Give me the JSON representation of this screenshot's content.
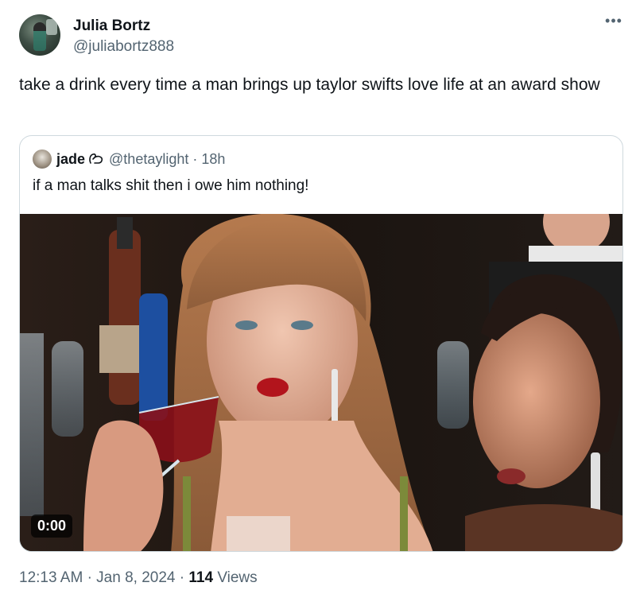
{
  "author": {
    "name": "Julia Bortz",
    "handle": "@juliabortz888"
  },
  "tweet": {
    "text": "take a drink every time a man brings up taylor swifts love life at an award show"
  },
  "quoted_tweet": {
    "name": "jade",
    "handle": "@thetaylight",
    "dot": "·",
    "time": "18h",
    "text": "if a man talks shit then i owe him nothing!",
    "video_duration": "0:00"
  },
  "meta": {
    "time": "12:13 AM",
    "sep1": "·",
    "date": "Jan 8, 2024",
    "sep2": "·",
    "views_count": "114",
    "views_label": "Views"
  },
  "icons": {
    "more": "more-horizontal-icon",
    "badge": "handshake-badge-icon"
  },
  "colors": {
    "text_primary": "#0f1419",
    "text_secondary": "#536471",
    "border": "#cfd9de"
  }
}
